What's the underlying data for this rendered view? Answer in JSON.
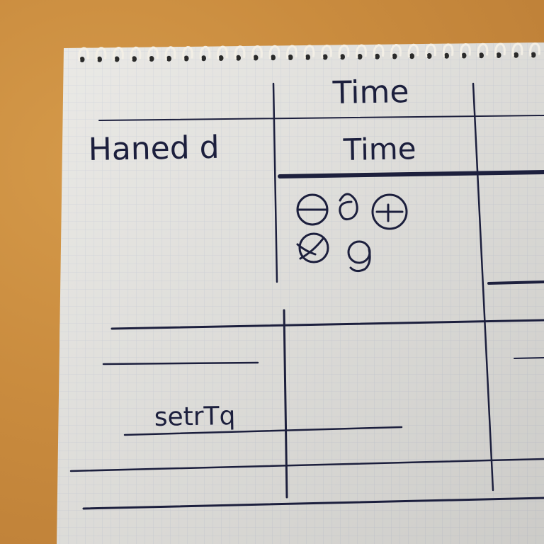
{
  "photo": {
    "background_color": "#c98b3e",
    "paper_color": "#e7e6e2",
    "grid_color": "#c9cdd6",
    "ink_color": "#1c1f3d",
    "binding": "spiral"
  },
  "notebook": {
    "header_top": "Time",
    "header_second": "Time",
    "left_label": "Haned d",
    "row_label": "setrTq",
    "scribble_row_1": "Θ δ Θ",
    "scribble_row_2": "∅ g"
  }
}
